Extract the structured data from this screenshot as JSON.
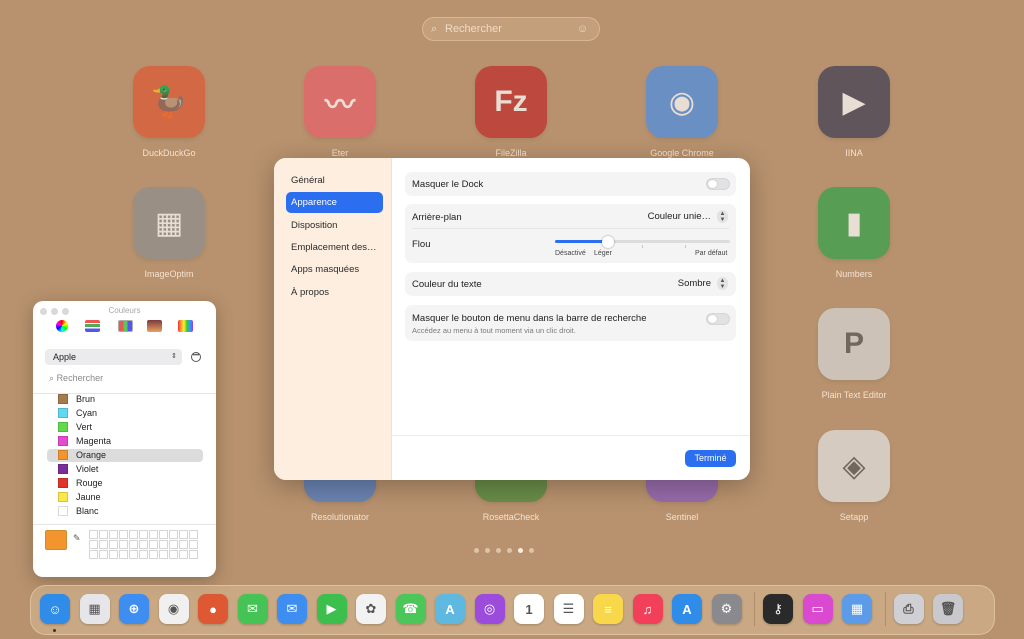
{
  "launchpad": {
    "search_placeholder": "Rechercher",
    "search_icon": "magnifier-icon",
    "apps": [
      {
        "name": "DuckDuckGo",
        "glyph": "🦆",
        "color": "#de5833"
      },
      {
        "name": "Eter",
        "glyph": "〰",
        "color": "#e8606a"
      },
      {
        "name": "FileZilla",
        "glyph": "Fz",
        "color": "#bf2a2a"
      },
      {
        "name": "Google Chrome",
        "glyph": "◉",
        "color": "#4a8ee8"
      },
      {
        "name": "IINA",
        "glyph": "▶",
        "color": "#3c3c54"
      },
      {
        "name": "ImageOptim",
        "glyph": "▦",
        "color": "#8e8e8e"
      },
      {
        "name": "Numbers",
        "glyph": "▮",
        "color": "#2fa34a"
      },
      {
        "name": "Plain Text Editor",
        "glyph": "P",
        "color": "#d7d7d7"
      },
      {
        "name": "Resolutionator",
        "glyph": "▭",
        "color": "#4b7fd0"
      },
      {
        "name": "RosettaCheck",
        "glyph": "◐",
        "color": "#4a8a3a"
      },
      {
        "name": "Sentinel",
        "glyph": "◆",
        "color": "#8a5bc4"
      },
      {
        "name": "Setapp",
        "glyph": "◈",
        "color": "#e4e4e4"
      }
    ],
    "page_count": 6,
    "active_page": 4
  },
  "settings": {
    "sidebar": [
      "Général",
      "Apparence",
      "Disposition",
      "Emplacement des…",
      "Apps masquées",
      "À propos"
    ],
    "selected_index": 1,
    "hide_dock_label": "Masquer le Dock",
    "background_label": "Arrière-plan",
    "background_value": "Couleur unie…",
    "blur_label": "Flou",
    "blur_value": 0.3,
    "blur_ticks": [
      "Désactivé",
      "Léger",
      "Par défaut"
    ],
    "text_color_label": "Couleur du texte",
    "text_color_value": "Sombre",
    "hide_menu_label": "Masquer le bouton de menu dans la barre de recherche",
    "hide_menu_sub": "Accédez au menu à tout moment via un clic droit.",
    "done_label": "Terminé",
    "accent_color": "#2b6ff0"
  },
  "colors_panel": {
    "title": "Couleurs",
    "palette_name": "Apple",
    "search_placeholder": "Rechercher",
    "items": [
      {
        "name": "Brun",
        "hex": "#a77a4a"
      },
      {
        "name": "Cyan",
        "hex": "#5fd8f2"
      },
      {
        "name": "Vert",
        "hex": "#62d94a"
      },
      {
        "name": "Magenta",
        "hex": "#e64ad3"
      },
      {
        "name": "Orange",
        "hex": "#f3952f"
      },
      {
        "name": "Violet",
        "hex": "#7a2f98"
      },
      {
        "name": "Rouge",
        "hex": "#e1352a"
      },
      {
        "name": "Jaune",
        "hex": "#f8e84a"
      },
      {
        "name": "Blanc",
        "hex": "#ffffff"
      }
    ],
    "selected_index": 4,
    "current_color": "#f3952f"
  },
  "dock": [
    {
      "name": "Finder",
      "glyph": "☺",
      "color": "#2f8ce8",
      "running": true
    },
    {
      "name": "Launchpad",
      "glyph": "▦",
      "color": "#e6e6ea",
      "running": false
    },
    {
      "name": "Safari",
      "glyph": "⊕",
      "color": "#3d8ef0",
      "running": false
    },
    {
      "name": "Google Chrome",
      "glyph": "◉",
      "color": "#f0f0f0",
      "running": false
    },
    {
      "name": "DuckDuckGo",
      "glyph": "●",
      "color": "#de5833",
      "running": false
    },
    {
      "name": "Messages",
      "glyph": "✉",
      "color": "#45c354",
      "running": false
    },
    {
      "name": "Mail",
      "glyph": "✉",
      "color": "#3d8ef0",
      "running": false
    },
    {
      "name": "FaceTime",
      "glyph": "▶",
      "color": "#3cbf4c",
      "running": false
    },
    {
      "name": "Photos",
      "glyph": "✿",
      "color": "#f2f2f2",
      "running": false
    },
    {
      "name": "Phone",
      "glyph": "☎",
      "color": "#4ac758",
      "running": false
    },
    {
      "name": "Maps",
      "glyph": "A",
      "color": "#5fb8e0",
      "running": false
    },
    {
      "name": "Podcasts",
      "glyph": "◎",
      "color": "#9b4cdc",
      "running": false
    },
    {
      "name": "Calendar",
      "glyph": "1",
      "color": "#ffffff",
      "running": false
    },
    {
      "name": "Reminders",
      "glyph": "☰",
      "color": "#ffffff",
      "running": false
    },
    {
      "name": "Notes",
      "glyph": "≡",
      "color": "#f8d84a",
      "running": false
    },
    {
      "name": "Music",
      "glyph": "♫",
      "color": "#f3405a",
      "running": false
    },
    {
      "name": "App Store",
      "glyph": "A",
      "color": "#2f8ce8",
      "running": false
    },
    {
      "name": "System Settings",
      "glyph": "⚙",
      "color": "#8a8a8e",
      "running": false
    },
    {
      "name": "Keys",
      "glyph": "⚷",
      "color": "#2a2a2a",
      "running": false
    },
    {
      "name": "CleanMyMac",
      "glyph": "▭",
      "color": "#d94ad0",
      "running": false
    },
    {
      "name": "Launchpad",
      "glyph": "▦",
      "color": "#5b9be8",
      "running": false
    },
    {
      "name": "Printer",
      "glyph": "⎙",
      "color": "#d0d0d4",
      "running": false
    },
    {
      "name": "Trash",
      "glyph": "🗑",
      "color": "#c9c9cd",
      "running": false
    }
  ]
}
